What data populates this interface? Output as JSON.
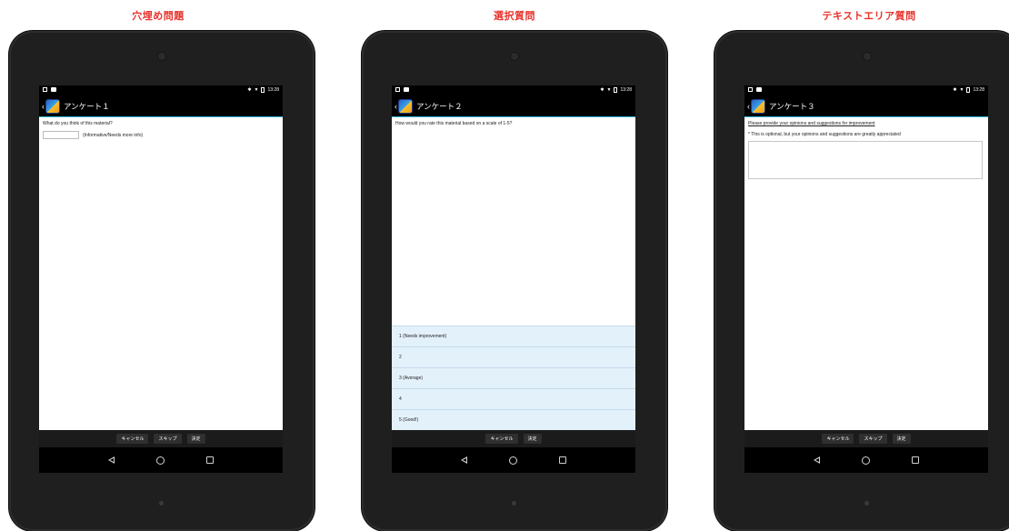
{
  "panels": [
    {
      "caption": "穴埋め問題",
      "status_time": "13:28",
      "title": "アンケート１",
      "question": "What do you think of this material?",
      "fill_hint": "(Informative/Needs more info)",
      "buttons": [
        "キャンセル",
        "スキップ",
        "決定"
      ]
    },
    {
      "caption": "選択質問",
      "status_time": "13:28",
      "title": "アンケート２",
      "question": "How would you rate this material based on a scale of 1-5?",
      "options": [
        "1 (Needs improvement)",
        "2",
        "3 (Average)",
        "4",
        "5 (Good!)"
      ],
      "buttons": [
        "キャンセル",
        "決定"
      ]
    },
    {
      "caption": "テキストエリア質問",
      "status_time": "13:28",
      "title": "アンケート３",
      "prompt": "Please provide your opinions and suggestions for improvement",
      "note": "* This is optional, but your opinions and suggestions are greatly appreciated",
      "buttons": [
        "キャンセル",
        "スキップ",
        "決定"
      ]
    }
  ],
  "icons": {
    "status_left": [
      "image-icon",
      "camera-icon"
    ],
    "status_right": [
      "bluetooth-icon",
      "wifi-icon",
      "battery-icon"
    ],
    "nav": [
      "back-nav-icon",
      "home-nav-icon",
      "recents-nav-icon"
    ]
  },
  "colors": {
    "caption": "#e8322b",
    "accent": "#33b5e5",
    "option_bg": "#e3f1fb"
  }
}
